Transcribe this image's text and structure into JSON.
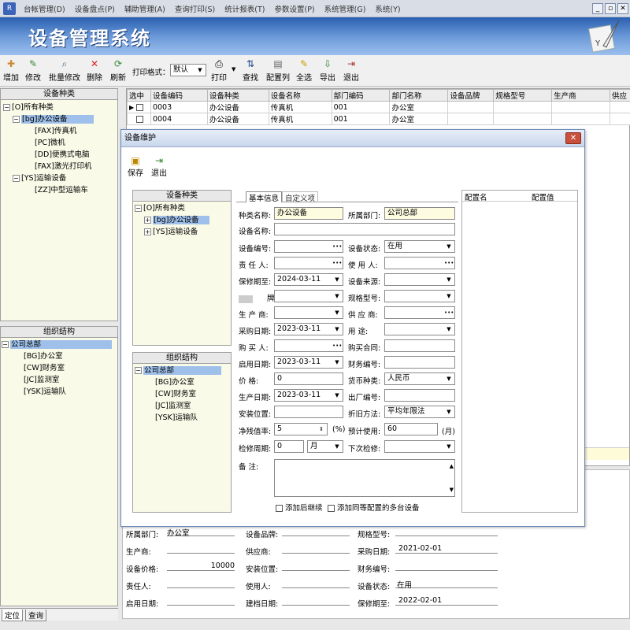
{
  "menu": [
    "台帐管理(D)",
    "设备盘点(P)",
    "辅助管理(A)",
    "查询打印(S)",
    "统计报表(T)",
    "参数设置(P)",
    "系统管理(G)",
    "系统(Y)"
  ],
  "app_title": "设备管理系统",
  "toolbar": {
    "add": "增加",
    "edit": "修改",
    "batch_edit": "批量修改",
    "delete": "删除",
    "refresh": "刷新",
    "print_format_label": "打印格式：",
    "print_format_value": "默认",
    "print": "打印",
    "find": "查找",
    "config_columns": "配置列",
    "select_all": "全选",
    "export": "导出",
    "exit": "退出"
  },
  "left": {
    "category_header": "设备种类",
    "category_tree": [
      "[O]所有种类",
      "[bg]办公设备",
      "[FAX]传真机",
      "[PC]微机",
      "[DD]便携式电脑",
      "[FAX]激光打印机",
      "[YS]运输设备",
      "[ZZ]中型运输车"
    ],
    "org_header": "组织结构",
    "org_tree": [
      "公司总部",
      "[BG]办公室",
      "[CW]财务室",
      "[JC]监测室",
      "[YSK]运输队"
    ],
    "tabs": [
      "定位",
      "查询"
    ]
  },
  "grid": {
    "columns": [
      "选中",
      "设备编码",
      "设备种类",
      "设备名称",
      "部门编码",
      "部门名称",
      "设备品牌",
      "规格型号",
      "生产商",
      "供应"
    ],
    "rows": [
      [
        "",
        "0003",
        "办公设备",
        "传真机",
        "001",
        "办公室",
        "",
        "",
        "",
        ""
      ],
      [
        "",
        "0004",
        "办公设备",
        "传真机",
        "001",
        "办公室",
        "",
        "",
        "",
        ""
      ]
    ]
  },
  "dialog": {
    "title": "设备维护",
    "save": "保存",
    "exit": "退出",
    "cat_header": "设备种类",
    "cat_tree": [
      "[O]所有种类",
      "[bg]办公设备",
      "[YS]运输设备"
    ],
    "org_header": "组织结构",
    "org_tree": [
      "公司总部",
      "[BG]办公室",
      "[CW]财务室",
      "[JC]监测室",
      "[YSK]运输队"
    ],
    "tabs": [
      "基本信息",
      "自定义项"
    ],
    "config_headers": [
      "配置名",
      "配置值"
    ],
    "f": {
      "category_label": "种类名称:",
      "category_value": "办公设备",
      "dept_label": "所属部门:",
      "dept_value": "公司总部",
      "name_label": "设备名称:",
      "code_label": "设备编号:",
      "status_label": "设备状态:",
      "status_value": "在用",
      "owner_label": "责 任 人:",
      "user_label": "使 用 人:",
      "warranty_label": "保修期至:",
      "warranty_value": "2024-03-11",
      "source_label": "设备来源:",
      "brand_label": "牌:",
      "model_label": "规格型号:",
      "maker_label": "生 产 商:",
      "supplier_label": "供 应 商:",
      "purchase_label": "采购日期:",
      "purchase_value": "2023-03-11",
      "use_label": "用    途:",
      "buyer_label": "购 买 人:",
      "contract_label": "购买合同:",
      "start_label": "启用日期:",
      "start_value": "2023-03-11",
      "finance_label": "财务编号:",
      "price_label": "价    格:",
      "price_value": "0",
      "currency_label": "货币种类:",
      "currency_value": "人民币",
      "made_label": "生产日期:",
      "made_value": "2023-03-11",
      "factory_label": "出厂编号:",
      "install_label": "安装位置:",
      "depr_label": "折旧方法:",
      "depr_value": "平均年限法",
      "residual_label": "净残值率:",
      "residual_value": "5",
      "residual_unit": "(%)",
      "life_label": "预计使用:",
      "life_value": "60",
      "life_unit": "(月)",
      "inspect_label": "检修周期:",
      "inspect_value": "0",
      "inspect_unit": "月",
      "next_label": "下次检修:",
      "remark_label": "备    注:",
      "continue_label": "添加后继续",
      "multi_label": "添加同等配置的多台设备"
    }
  },
  "detail": {
    "dept_label": "所属部门:",
    "dept_value": "办公室",
    "brand_label": "设备品牌:",
    "model_label": "规格型号:",
    "maker_label": "生产商:",
    "supplier_label": "供应商:",
    "purchase_label": "采购日期:",
    "purchase_value": "2021-02-01",
    "price_label": "设备价格:",
    "price_value": "10000",
    "install_label": "安装位置:",
    "finance_label": "财务编号:",
    "owner_label": "责任人:",
    "user_label": "使用人:",
    "status_label": "设备状态:",
    "status_value": "在用",
    "start_label": "启用日期:",
    "archive_label": "建档日期:",
    "warranty_label": "保修期至:",
    "warranty_value": "2022-02-01"
  },
  "colors": {
    "accent": "#2a5fb0",
    "selection": "#9ec0ea",
    "panel": "#fafae8"
  }
}
